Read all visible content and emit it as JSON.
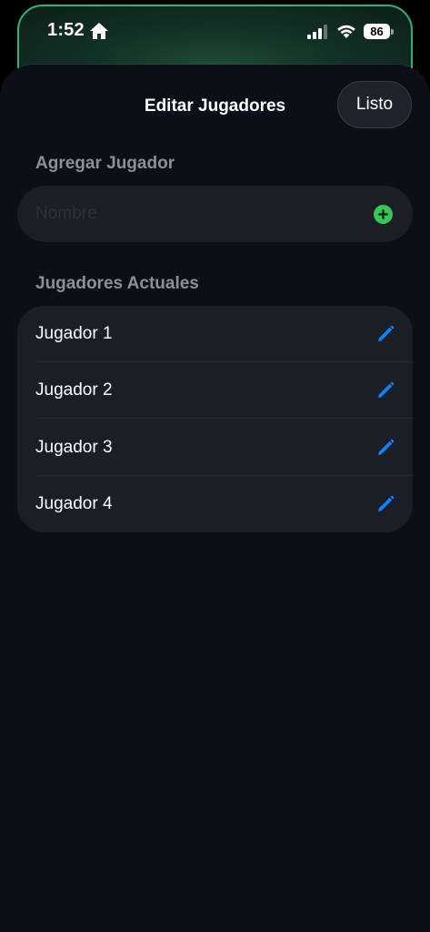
{
  "status_bar": {
    "time": "1:52",
    "battery_level": "86",
    "icons": [
      "home-icon",
      "cellular-signal-icon",
      "wifi-icon",
      "battery-icon"
    ]
  },
  "sheet": {
    "title": "Editar Jugadores",
    "done_label": "Listo"
  },
  "add_player": {
    "header": "Agregar Jugador",
    "input_value": "",
    "input_placeholder": "Nombre",
    "add_icon": "plus-circle-icon"
  },
  "current_players": {
    "header": "Jugadores Actuales",
    "players": [
      {
        "name": "Jugador 1",
        "icon": "pencil-icon"
      },
      {
        "name": "Jugador 2",
        "icon": "pencil-icon"
      },
      {
        "name": "Jugador 3",
        "icon": "pencil-icon"
      },
      {
        "name": "Jugador 4",
        "icon": "pencil-icon"
      }
    ]
  },
  "colors": {
    "accent_blue": "#0a84ff",
    "add_green": "#34c759",
    "sheet_background": "#0d0f17",
    "card_background": "#1c1e25",
    "background_card_border": "#2fb37a"
  }
}
